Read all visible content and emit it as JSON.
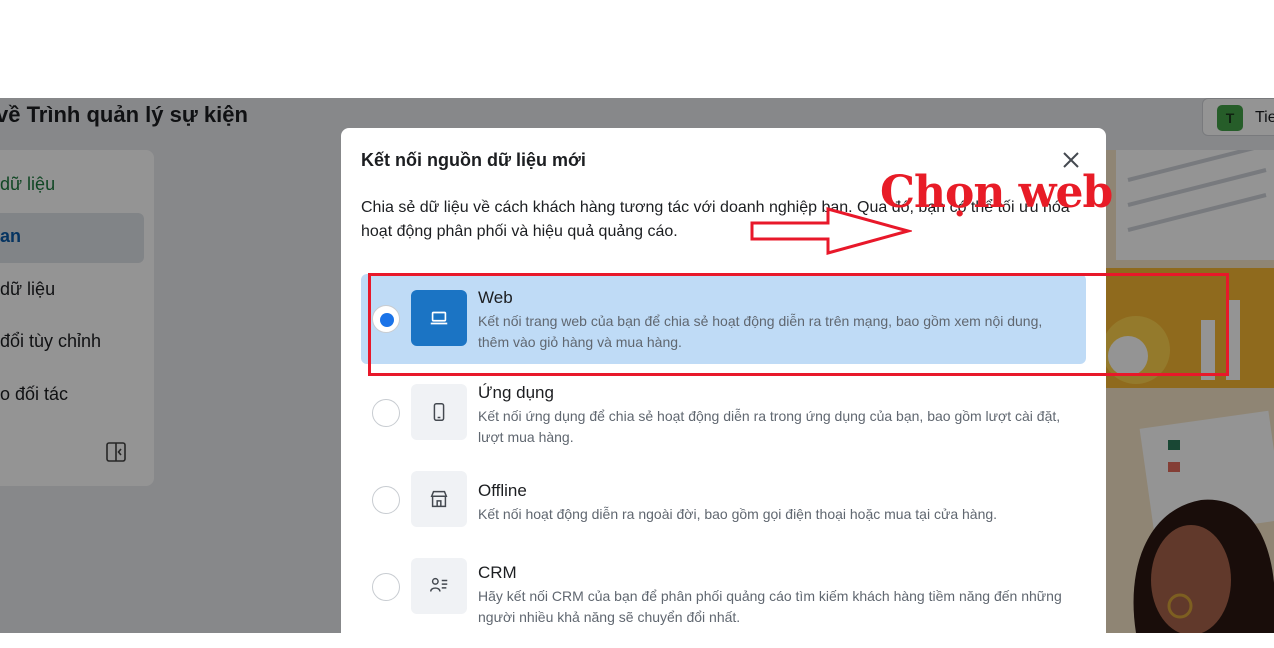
{
  "background_page": {
    "title": "về Trình quản lý sự kiện",
    "sidebar_items": [
      {
        "label": "dữ liệu"
      },
      {
        "label": "an"
      },
      {
        "label": "dữ liệu"
      },
      {
        "label": "đổi tùy chỉnh"
      },
      {
        "label": "o đối tác"
      }
    ],
    "account": {
      "initial": "T",
      "name": "Tie"
    }
  },
  "dialog": {
    "title": "Kết nối nguồn dữ liệu mới",
    "description": "Chia sẻ dữ liệu về cách khách hàng tương tác với doanh nghiệp bạn. Qua đó, bạn có thể tối ưu hóa hoạt động phân phối và hiệu quả quảng cáo.",
    "selected_option": "Web",
    "options": [
      {
        "title": "Web",
        "description": "Kết nối trang web của bạn để chia sẻ hoạt động diễn ra trên mạng, bao gồm xem nội dung, thêm vào giỏ hàng và mua hàng.",
        "icon": "laptop-icon"
      },
      {
        "title": "Ứng dụng",
        "description": "Kết nối ứng dụng để chia sẻ hoạt động diễn ra trong ứng dụng của bạn, bao gồm lượt cài đặt, lượt mua hàng.",
        "icon": "phone-icon"
      },
      {
        "title": "Offline",
        "description": "Kết nối hoạt động diễn ra ngoài đời, bao gồm gọi điện thoại hoặc mua tại cửa hàng.",
        "icon": "store-icon"
      },
      {
        "title": "CRM",
        "description": "Hãy kết nối CRM của bạn để phân phối quảng cáo tìm kiếm khách hàng tiềm năng đến những người nhiều khả năng sẽ chuyển đổi nhất.",
        "icon": "people-icon"
      }
    ]
  },
  "annotation": {
    "text": "Chọn web",
    "color": "#e81c27"
  },
  "colors": {
    "accent": "#1a73e8",
    "selected_bg": "#bfdbf6",
    "web_icon_bg": "#1b74c4"
  }
}
